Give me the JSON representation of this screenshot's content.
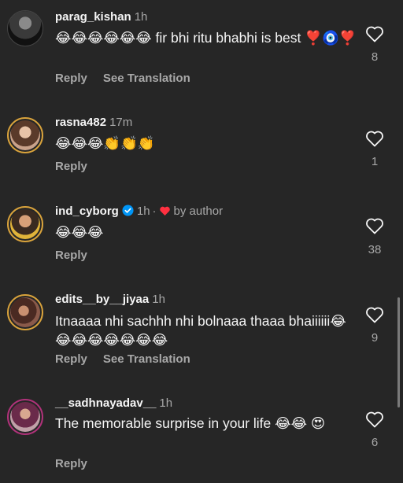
{
  "comments": [
    {
      "username": "parag_kishan",
      "time": "1h",
      "text": "😂😂😂😂😂😂 fir bhi ritu bhabhi is best ❣️🧿❣️",
      "reply_label": "Reply",
      "translation_label": "See Translation",
      "likes": "8"
    },
    {
      "username": "rasna482",
      "time": "17m",
      "text": "😂😂😂👏👏👏",
      "reply_label": "Reply",
      "likes": "1"
    },
    {
      "username": "ind_cyborg",
      "time": "1h",
      "author_liked": "by author",
      "text": "😂😂😂",
      "reply_label": "Reply",
      "likes": "38"
    },
    {
      "username": "edits__by__jiyaa",
      "time": "1h",
      "text": "Itnaaaa nhi sachhh nhi bolnaaa thaaa bhaiiiiii😂😂😂😂😂😂😂😂",
      "reply_label": "Reply",
      "translation_label": "See Translation",
      "likes": "9"
    },
    {
      "username": "__sadhnayadav__",
      "time": "1h",
      "text": "The memorable surprise in your life 😂😂 😍",
      "reply_label": "Reply",
      "likes": "6"
    }
  ],
  "colors": {
    "background": "#262626",
    "primary_text": "#f5f5f5",
    "secondary_text": "#a8a8a8",
    "author_heart": "#ff3040",
    "verified_badge": "#0095f6",
    "story_ring": "#d9a33c"
  },
  "icons": {
    "like": "heart-outline-icon",
    "author_like": "heart-filled-icon",
    "verified": "verified-badge-icon"
  }
}
